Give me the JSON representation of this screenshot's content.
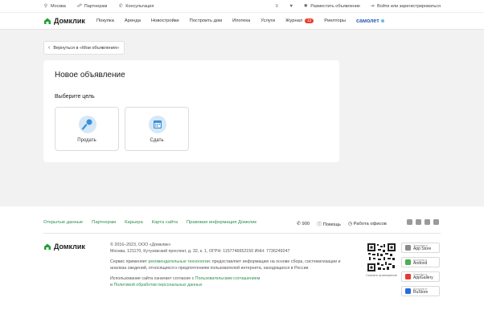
{
  "topbar": {
    "city": "Москва",
    "partners": "Партнерам",
    "consult": "Консультация",
    "post_ad": "Разместить объявление",
    "login": "Войти или зарегистрироваться"
  },
  "nav": {
    "logo": "Домклик",
    "links": [
      "Покупка",
      "Аренда",
      "Новостройки",
      "Построить дом",
      "Ипотека",
      "Услуги",
      "Журнал",
      "Риелторы"
    ],
    "journal_badge": "12",
    "samolet": "самолет"
  },
  "back_button": "Вернуться в «Мои объявления»",
  "card": {
    "title": "Новое объявление",
    "subtitle": "Выберите цель",
    "options": [
      "Продать",
      "Сдать"
    ]
  },
  "footer": {
    "links": [
      "Открытые данные",
      "Партнерам",
      "Карьера",
      "Карта сайта",
      "Правовая информация Домклик"
    ],
    "phone": "900",
    "help": "Помощь",
    "offices": "Работа офисов",
    "logo": "Домклик",
    "copyright": "© 2016–2023, ООО «Домклик»",
    "address": "Москва, 121170, Кутузовский проспект, д. 32, к. 1, ОГРН: 1157746652150 ИНН: 7736249247",
    "service_1": "Сервис применяет",
    "service_link": "рекомендательные технологии",
    "service_2": ": предоставляет информацию на основе сбора, систематизации и анализа сведений, относящихся к предпочтениям пользователей интернета, находящихся в России",
    "agree_1": "Использование сайта означает согласие с",
    "agree_link1": "Пользовательским соглашением",
    "agree_and": "и",
    "agree_link2": "Политикой обработки персональных данных",
    "qr_caption": "Скачать приложение",
    "stores": [
      {
        "top": "Загрузите в",
        "name": "App Store",
        "color": "#8a8a8a"
      },
      {
        "top": "Доступно в",
        "name": "Android",
        "color": "#4caf50"
      },
      {
        "top": "Откройте в",
        "name": "AppGallery",
        "color": "#e53935"
      },
      {
        "top": "Доступно в",
        "name": "RuStore",
        "color": "#2a6be0"
      }
    ]
  }
}
